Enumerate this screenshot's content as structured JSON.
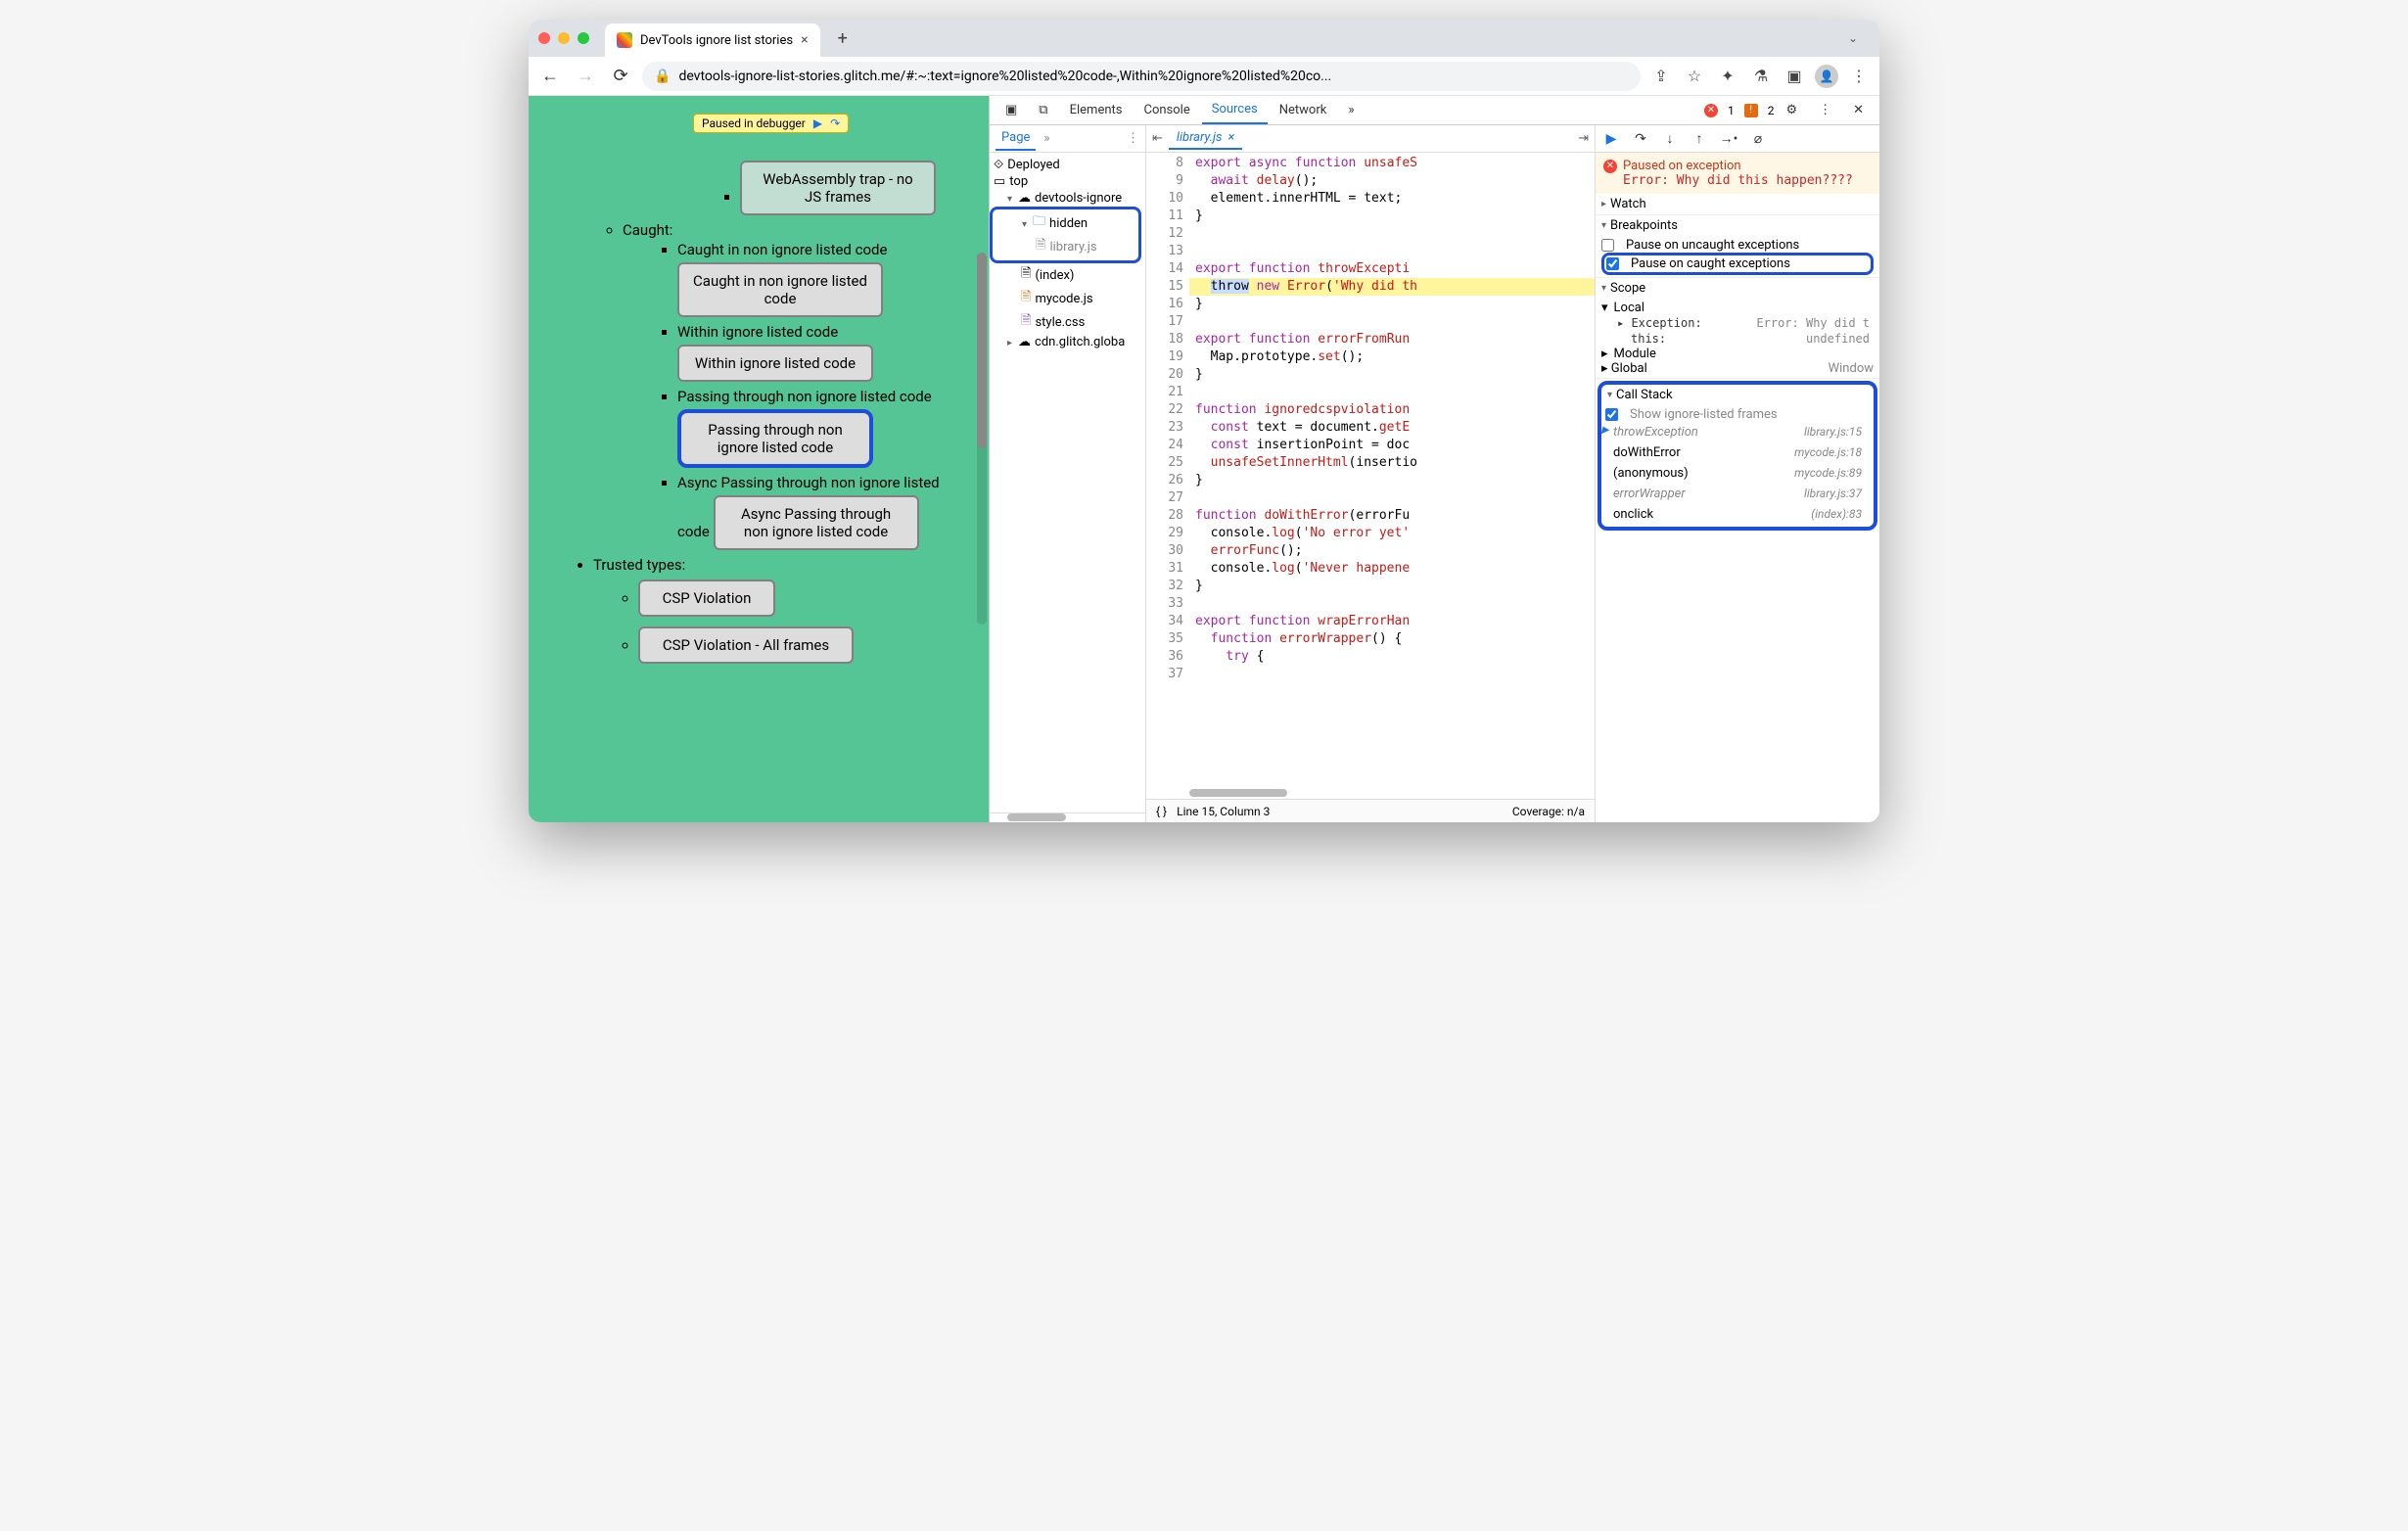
{
  "browser": {
    "tab_title": "DevTools ignore list stories",
    "url": "devtools-ignore-list-stories.glitch.me/#:~:text=ignore%20listed%20code-,Within%20ignore%20listed%20co..."
  },
  "paused_pill": {
    "label": "Paused in debugger"
  },
  "page_content": {
    "wasm_btn": "WebAssembly trap - no JS frames",
    "caught_heading": "Caught:",
    "caught_item": "Caught in non ignore listed code",
    "caught_btn": "Caught in non ignore listed code",
    "within_item": "Within ignore listed code",
    "within_btn": "Within ignore listed code",
    "passing_item": "Passing through non ignore listed code",
    "passing_btn": "Passing through non ignore listed code",
    "async_item": "Async Passing through non ignore listed code",
    "async_btn": "Async Passing through non ignore listed code",
    "trusted_heading": "Trusted types:",
    "csp_btn": "CSP Violation",
    "csp_all_btn": "CSP Violation - All frames"
  },
  "devtools": {
    "tabs": {
      "elements": "Elements",
      "console": "Console",
      "sources": "Sources",
      "network": "Network"
    },
    "errors": "1",
    "warnings": "2"
  },
  "src_nav": {
    "tabs": {
      "page": "Page"
    },
    "tree": {
      "deployed": "Deployed",
      "top": "top",
      "origin": "devtools-ignore",
      "hidden": "hidden",
      "library": "library.js",
      "index": "(index)",
      "mycode": "mycode.js",
      "style": "style.css",
      "cdn": "cdn.glitch.globa"
    }
  },
  "editor": {
    "open_file": "library.js",
    "lines": [
      {
        "n": 8,
        "html": "<span class='kw'>export</span> <span class='kw'>async</span> <span class='kw'>function</span> <span class='ctor'>unsafeS</span>"
      },
      {
        "n": 9,
        "html": "  <span class='kw'>await</span> <span class='fn'>delay</span>();"
      },
      {
        "n": 10,
        "html": "  element.<span class='id'>innerHTML</span> = text;"
      },
      {
        "n": 11,
        "html": "}"
      },
      {
        "n": 12,
        "html": " "
      },
      {
        "n": 13,
        "html": " "
      },
      {
        "n": 14,
        "html": "<span class='kw'>export</span> <span class='kw'>function</span> <span class='ctor'>throwExcepti</span>"
      },
      {
        "n": 15,
        "html": "  <span class='sel'>throw</span> <span class='kw'>new</span> <span class='ctor'>Error</span>(<span class='str'>'Why did th</span>",
        "hl": true
      },
      {
        "n": 16,
        "html": "}"
      },
      {
        "n": 17,
        "html": " "
      },
      {
        "n": 18,
        "html": "<span class='kw'>export</span> <span class='kw'>function</span> <span class='ctor'>errorFromRun</span>"
      },
      {
        "n": 19,
        "html": "  Map.prototype.<span class='fn'>set</span>();"
      },
      {
        "n": 20,
        "html": "}"
      },
      {
        "n": 21,
        "html": " "
      },
      {
        "n": 22,
        "html": "<span class='kw'>function</span> <span class='ctor'>ignoredcspviolation</span>"
      },
      {
        "n": 23,
        "html": "  <span class='kw'>const</span> text = document.<span class='fn'>getE</span>"
      },
      {
        "n": 24,
        "html": "  <span class='kw'>const</span> insertionPoint = doc"
      },
      {
        "n": 25,
        "html": "  <span class='fn'>unsafeSetInnerHtml</span>(insertio"
      },
      {
        "n": 26,
        "html": "}"
      },
      {
        "n": 27,
        "html": " "
      },
      {
        "n": 28,
        "html": "<span class='kw'>function</span> <span class='ctor'>doWithError</span>(errorFu"
      },
      {
        "n": 29,
        "html": "  console.<span class='fn'>log</span>(<span class='str'>'No error yet'</span>"
      },
      {
        "n": 30,
        "html": "  <span class='fn'>errorFunc</span>();"
      },
      {
        "n": 31,
        "html": "  console.<span class='fn'>log</span>(<span class='str'>'Never happene</span>"
      },
      {
        "n": 32,
        "html": "}"
      },
      {
        "n": 33,
        "html": " "
      },
      {
        "n": 34,
        "html": "<span class='kw'>export</span> <span class='kw'>function</span> <span class='ctor'>wrapErrorHan</span>"
      },
      {
        "n": 35,
        "html": "  <span class='kw'>function</span> <span class='ctor'>errorWrapper</span>() {"
      },
      {
        "n": 36,
        "html": "    <span class='kw'>try</span> {"
      },
      {
        "n": 37,
        "html": "      "
      }
    ],
    "status_line": "Line 15, Column 3",
    "coverage": "Coverage: n/a"
  },
  "dbg": {
    "paused_title": "Paused on exception",
    "paused_msg": "Error: Why did this happen????",
    "watch": "Watch",
    "breakpoints": "Breakpoints",
    "uncaught": "Pause on uncaught exceptions",
    "caught": "Pause on caught exceptions",
    "scope": "Scope",
    "local": "Local",
    "exception_lbl": "Exception",
    "exception_val": "Error: Why did t",
    "this_lbl": "this",
    "this_val": "undefined",
    "module": "Module",
    "global": "Global",
    "global_val": "Window",
    "callstack": "Call Stack",
    "show_ignored": "Show ignore-listed frames",
    "frames": [
      {
        "name": "throwException",
        "loc": "library.js:15",
        "ignored": true,
        "active": true
      },
      {
        "name": "doWithError",
        "loc": "mycode.js:18",
        "ignored": false
      },
      {
        "name": "(anonymous)",
        "loc": "mycode.js:89",
        "ignored": false
      },
      {
        "name": "errorWrapper",
        "loc": "library.js:37",
        "ignored": true
      },
      {
        "name": "onclick",
        "loc": "(index):83",
        "ignored": false
      }
    ]
  }
}
